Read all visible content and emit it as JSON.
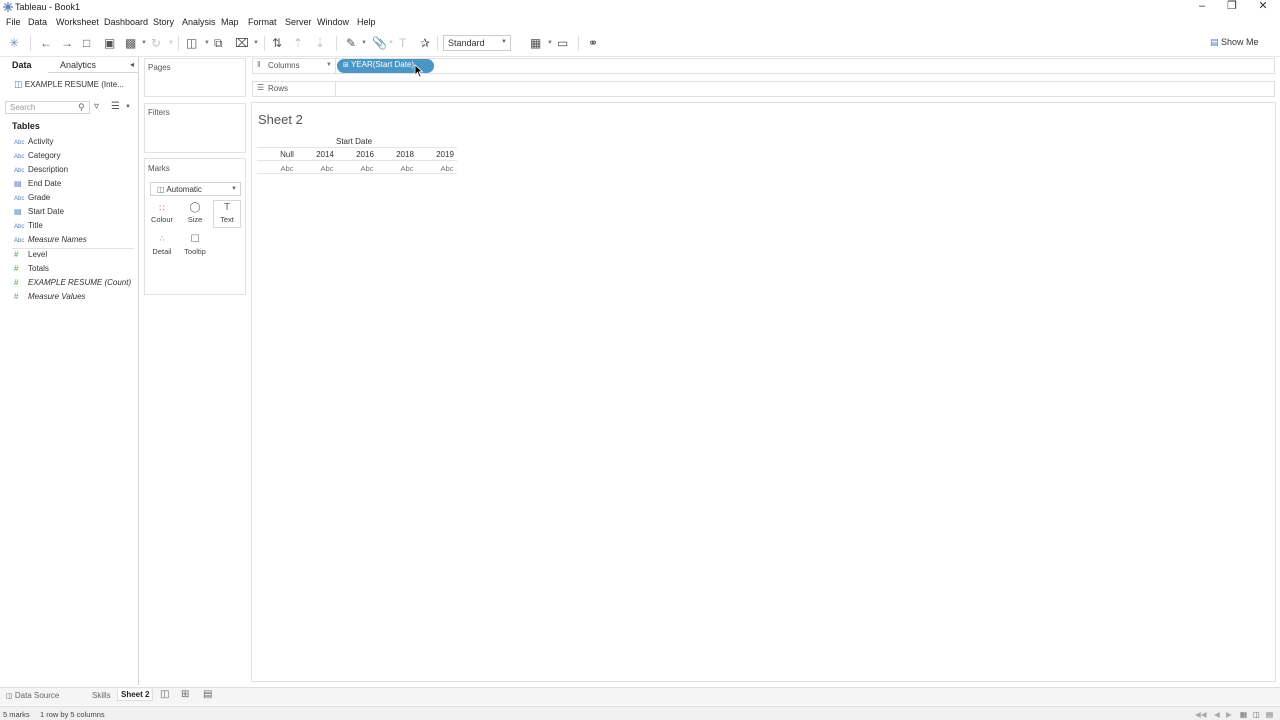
{
  "window": {
    "title": "Tableau - Book1"
  },
  "menu": [
    "File",
    "Data",
    "Worksheet",
    "Dashboard",
    "Story",
    "Analysis",
    "Map",
    "Format",
    "Server",
    "Window",
    "Help"
  ],
  "toolbar": {
    "fit": "Standard",
    "show_me": "Show Me"
  },
  "data_pane": {
    "tabs": [
      "Data",
      "Analytics"
    ],
    "datasource": "EXAMPLE RESUME (Inte...",
    "search_placeholder": "Search",
    "tables_label": "Tables",
    "dimensions": [
      {
        "icon": "Abc",
        "name": "Activity"
      },
      {
        "icon": "Abc",
        "name": "Category"
      },
      {
        "icon": "Abc",
        "name": "Description"
      },
      {
        "icon": "date",
        "name": "End Date"
      },
      {
        "icon": "Abc",
        "name": "Grade"
      },
      {
        "icon": "date",
        "name": "Start Date"
      },
      {
        "icon": "Abc",
        "name": "Title"
      },
      {
        "icon": "Abc",
        "name": "Measure Names"
      }
    ],
    "measures": [
      {
        "icon": "#",
        "name": "Level"
      },
      {
        "icon": "#",
        "name": "Totals"
      },
      {
        "icon": "#",
        "name": "EXAMPLE RESUME (Count)"
      },
      {
        "icon": "#",
        "name": "Measure Values"
      }
    ]
  },
  "cards": {
    "pages": "Pages",
    "filters": "Filters",
    "marks": "Marks",
    "mark_type": "Automatic",
    "mark_buttons": [
      "Colour",
      "Size",
      "Text",
      "Detail",
      "Tooltip"
    ]
  },
  "shelves": {
    "columns_label": "Columns",
    "rows_label": "Rows",
    "columns_pill": "YEAR(Start Date)"
  },
  "sheet": {
    "title": "Sheet 2",
    "column_header": "Start Date",
    "columns": [
      "Null",
      "2014",
      "2016",
      "2018",
      "2019"
    ],
    "cells": [
      "Abc",
      "Abc",
      "Abc",
      "Abc",
      "Abc"
    ]
  },
  "tabs": [
    "Data Source",
    "Skills",
    "Sheet 2"
  ],
  "status": {
    "marks": "5 marks",
    "layout": "1 row by 5 columns"
  }
}
